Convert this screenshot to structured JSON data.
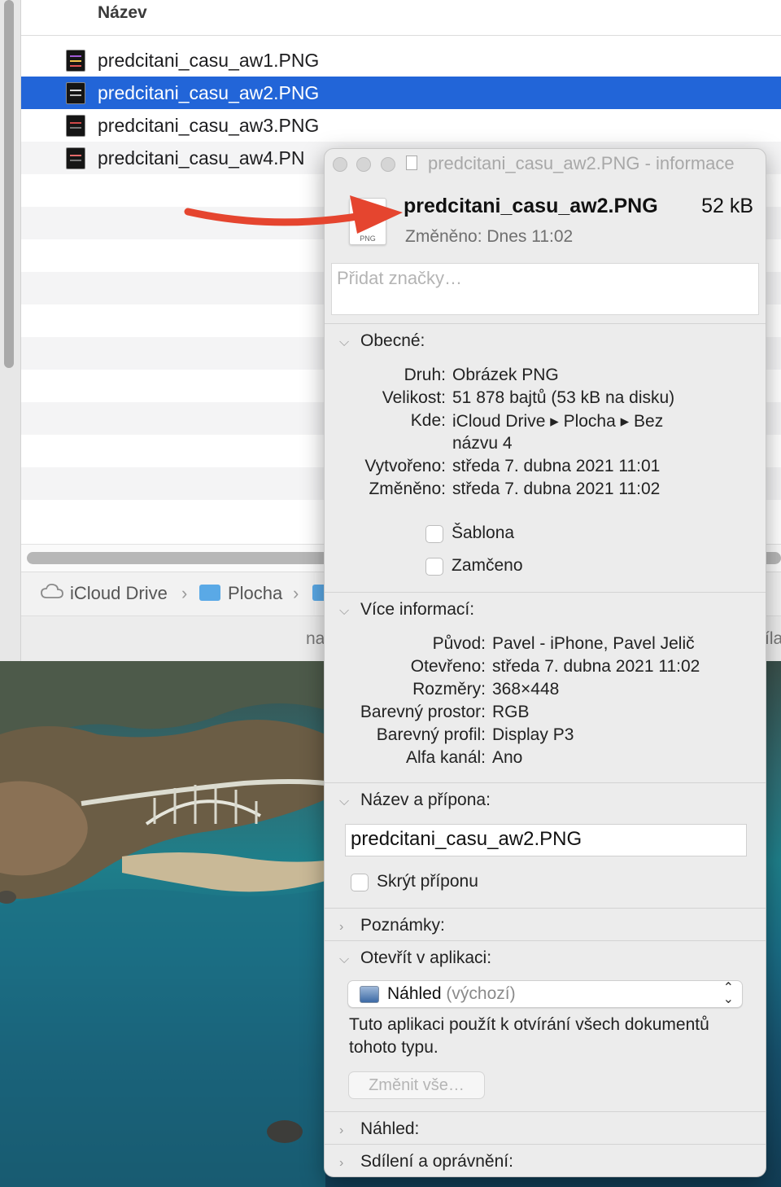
{
  "finder": {
    "column_header": "Název",
    "files": [
      {
        "name": "predcitani_casu_aw1.PNG",
        "selected": false
      },
      {
        "name": "predcitani_casu_aw2.PNG",
        "selected": true
      },
      {
        "name": "predcitani_casu_aw3.PNG",
        "selected": false
      },
      {
        "name": "predcitani_casu_aw4.PN",
        "selected": false
      }
    ],
    "pathbar": [
      "iCloud Drive",
      "Plocha"
    ],
    "status_left": "na",
    "status_right": "íla"
  },
  "info": {
    "title": "predcitani_casu_aw2.PNG - informace",
    "file_name": "predcitani_casu_aw2.PNG",
    "file_size": "52 kB",
    "icon_label": "PNG",
    "modified_line": "Změněno: Dnes 11:02",
    "tags_placeholder": "Přidat značky…",
    "general": {
      "title": "Obecné:",
      "druh_k": "Druh:",
      "druh_v": "Obrázek PNG",
      "velikost_k": "Velikost:",
      "velikost_v": "51 878 bajtů (53 kB na disku)",
      "kde_k": "Kde:",
      "kde_v1": "iCloud Drive ▸ Plocha ▸ Bez",
      "kde_v2": "názvu 4",
      "vytvoreno_k": "Vytvořeno:",
      "vytvoreno_v": "středa 7. dubna 2021 11:01",
      "zmeneno_k": "Změněno:",
      "zmeneno_v": "středa 7. dubna 2021 11:02",
      "sablona": "Šablona",
      "zamceno": "Zamčeno"
    },
    "more": {
      "title": "Více informací:",
      "puvod_k": "Původ:",
      "puvod_v": "Pavel - iPhone, Pavel Jelič",
      "otevreno_k": "Otevřeno:",
      "otevreno_v": "středa 7. dubna 2021 11:02",
      "rozmery_k": "Rozměry:",
      "rozmery_v": "368×448",
      "prostor_k": "Barevný prostor:",
      "prostor_v": "RGB",
      "profil_k": "Barevný profil:",
      "profil_v": "Display P3",
      "alfa_k": "Alfa kanál:",
      "alfa_v": "Ano"
    },
    "name_ext": {
      "title": "Název a přípona:",
      "value": "predcitani_casu_aw2.PNG",
      "hide_ext": "Skrýt příponu"
    },
    "notes_title": "Poznámky:",
    "open_with": {
      "title": "Otevřít v aplikaci:",
      "app": "Náhled",
      "default": "(výchozí)",
      "description": "Tuto aplikaci použít k otvírání všech dokumentů tohoto typu.",
      "change_all": "Změnit vše…"
    },
    "preview_title": "Náhled:",
    "sharing_title": "Sdílení a oprávnění:"
  },
  "colors": {
    "selection": "#2265d8",
    "arrow": "#e5452f"
  }
}
